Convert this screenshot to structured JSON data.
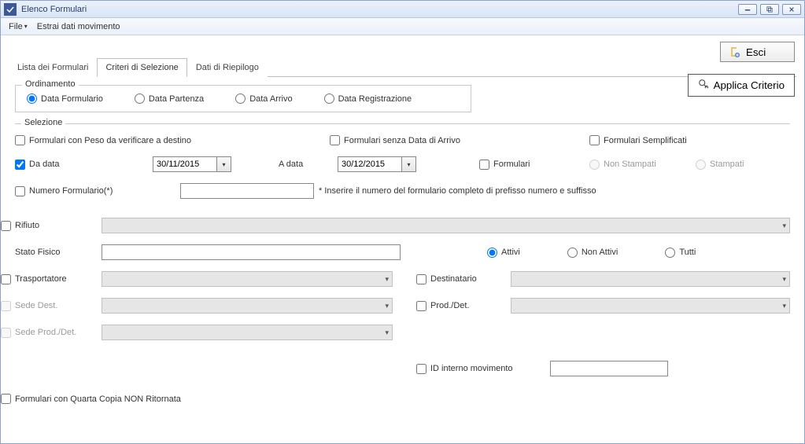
{
  "window": {
    "title": "Elenco Formulari"
  },
  "menubar": {
    "file": "File",
    "estrai": "Estrai dati movimento"
  },
  "buttons": {
    "esci": "Esci",
    "applica": "Applica Criterio"
  },
  "tabs": {
    "lista": "Lista dei Formulari",
    "criteri": "Criteri di Selezione",
    "riepilogo": "Dati di Riepilogo"
  },
  "ordinamento": {
    "legend": "Ordinamento",
    "data_formulario": "Data Formulario",
    "data_partenza": "Data Partenza",
    "data_arrivo": "Data Arrivo",
    "data_registrazione": "Data Registrazione"
  },
  "selezione": {
    "legend": "Selezione",
    "peso_verificare": "Formulari con Peso da verificare a destino",
    "senza_arrivo": "Formulari senza Data di Arrivo",
    "semplificati": "Formulari Semplificati",
    "da_data": "Da data",
    "da_data_val": "30/11/2015",
    "a_data": "A data",
    "a_data_val": "30/12/2015",
    "formulari": "Formulari",
    "non_stampati": "Non Stampati",
    "stampati": "Stampati",
    "numero_formulario": "Numero Formulario(*)",
    "hint_numero": "* Inserire il numero del formulario completo di prefisso numero e suffisso",
    "rifiuto": "Rifiuto",
    "stato_fisico": "Stato Fisico",
    "attivi": "Attivi",
    "non_attivi": "Non Attivi",
    "tutti": "Tutti",
    "trasportatore": "Trasportatore",
    "destinatario": "Destinatario",
    "sede_dest": "Sede Dest.",
    "prod_det": "Prod./Det.",
    "sede_prod_det": "Sede Prod./Det.",
    "id_interno": "ID interno movimento",
    "quarta_copia": "Formulari con Quarta Copia NON Ritornata"
  }
}
